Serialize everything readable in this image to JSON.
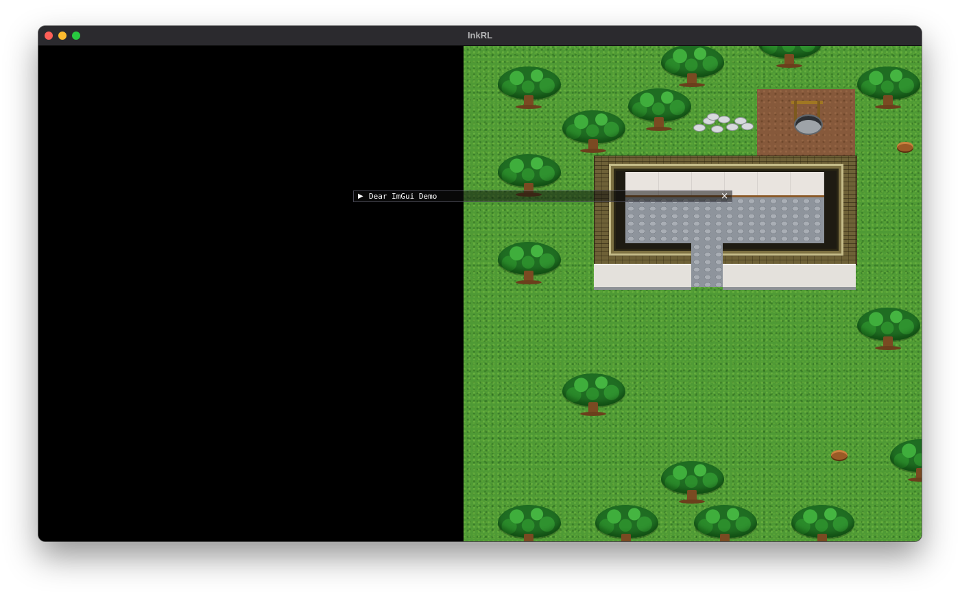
{
  "window": {
    "title": "InkRL"
  },
  "imgui_window": {
    "collapse_arrow": "▶",
    "title": "Dear ImGui Demo",
    "close_glyph": "×"
  },
  "map": {
    "terrain": "grass",
    "objects": [
      "trees",
      "stumps",
      "well",
      "rocks",
      "stone-building"
    ]
  }
}
